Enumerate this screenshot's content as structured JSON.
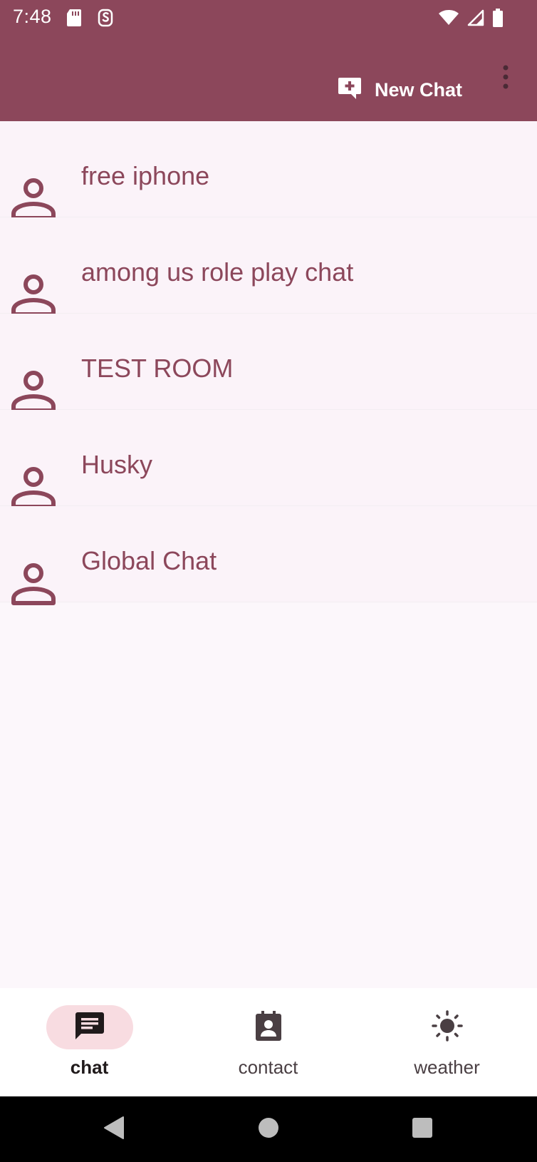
{
  "status_bar": {
    "time": "7:48",
    "icons": [
      "sd-card-icon",
      "app-s-icon",
      "wifi-icon",
      "signal-icon",
      "battery-icon"
    ]
  },
  "app_bar": {
    "new_chat_label": "New Chat",
    "new_chat_icon": "add-comment-icon",
    "overflow_icon": "more-vert-icon",
    "background_color": "#8C475B"
  },
  "chats": [
    {
      "title": "free iphone"
    },
    {
      "title": "among us role play chat"
    },
    {
      "title": "TEST ROOM"
    },
    {
      "title": "Husky"
    },
    {
      "title": "Global Chat"
    }
  ],
  "bottom_nav": {
    "items": [
      {
        "label": "chat",
        "icon": "chat-icon",
        "active": true
      },
      {
        "label": "contact",
        "icon": "contact-icon",
        "active": false
      },
      {
        "label": "weather",
        "icon": "sun-icon",
        "active": false
      }
    ]
  },
  "system_nav": {
    "icons": [
      "back-icon",
      "home-icon",
      "recents-icon"
    ]
  },
  "colors": {
    "accent": "#8C475B",
    "list_background": "#FBF3F9",
    "active_pill": "#F8DCE1"
  }
}
